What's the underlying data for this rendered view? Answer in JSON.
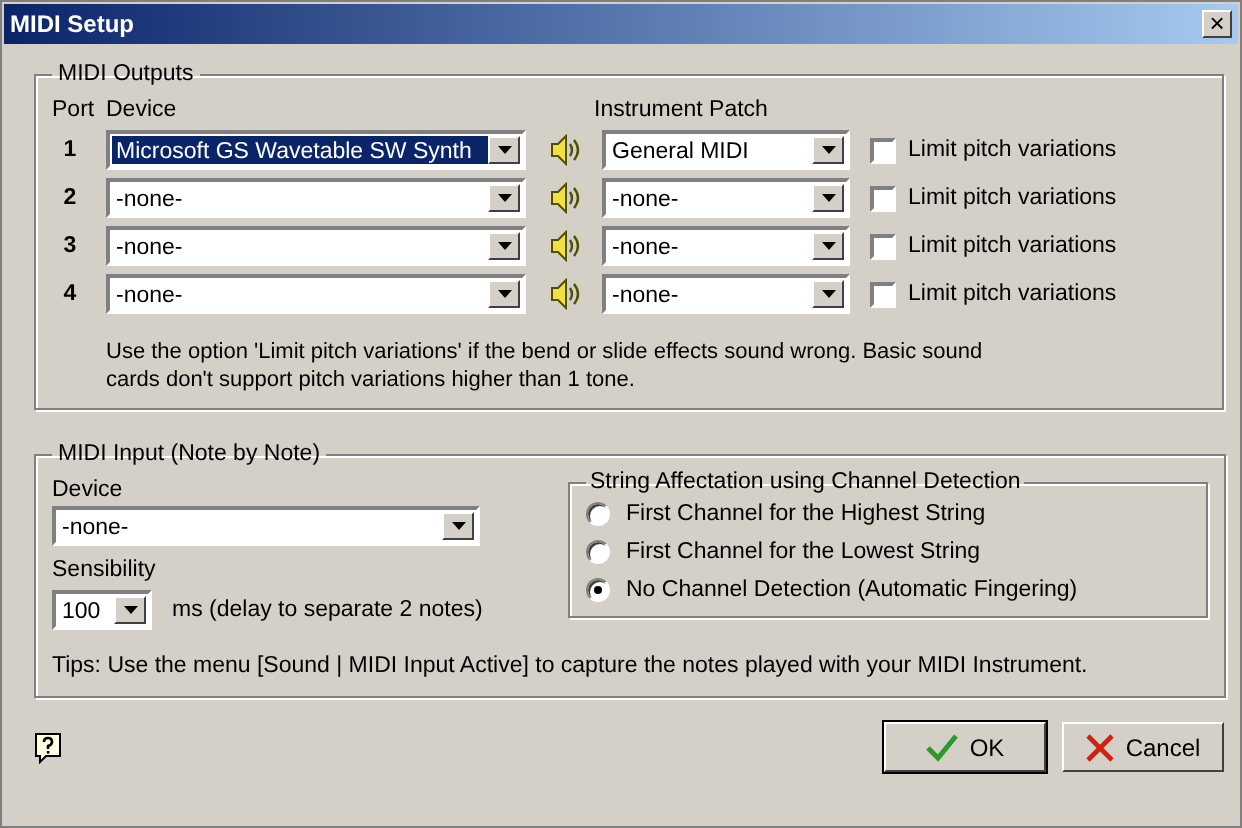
{
  "window": {
    "title": "MIDI Setup",
    "close": "×"
  },
  "midi_outputs": {
    "title": "MIDI Outputs",
    "headers": {
      "port": "Port",
      "device": "Device",
      "patch": "Instrument Patch"
    },
    "rows": [
      {
        "port": "1",
        "device": "Microsoft GS Wavetable SW Synth",
        "highlighted": true,
        "patch": "General MIDI",
        "limit_label": "Limit pitch variations",
        "checked": false
      },
      {
        "port": "2",
        "device": "-none-",
        "highlighted": false,
        "patch": "-none-",
        "limit_label": "Limit pitch variations",
        "checked": false
      },
      {
        "port": "3",
        "device": "-none-",
        "highlighted": false,
        "patch": "-none-",
        "limit_label": "Limit pitch variations",
        "checked": false
      },
      {
        "port": "4",
        "device": "-none-",
        "highlighted": false,
        "patch": "-none-",
        "limit_label": "Limit pitch variations",
        "checked": false
      }
    ],
    "note": "Use the option 'Limit pitch variations' if the bend or slide effects sound wrong. Basic sound cards don't support pitch variations higher than 1 tone."
  },
  "midi_input": {
    "title": "MIDI Input (Note by Note)",
    "device_label": "Device",
    "device": "-none-",
    "sensibility_label": "Sensibility",
    "sensibility": "100",
    "unit_label": "ms  (delay to separate 2 notes)",
    "detection": {
      "title": "String Affectation using Channel Detection",
      "options": [
        {
          "label": "First Channel for the Highest String",
          "selected": false
        },
        {
          "label": "First Channel for the Lowest String",
          "selected": false
        },
        {
          "label": "No Channel Detection (Automatic Fingering)",
          "selected": true
        }
      ]
    },
    "tips": "Tips: Use the menu [Sound | MIDI Input Active] to capture the notes played with your MIDI Instrument."
  },
  "buttons": [
    {
      "label": "OK",
      "kind": "ok"
    },
    {
      "label": "Cancel",
      "kind": "cancel"
    }
  ]
}
